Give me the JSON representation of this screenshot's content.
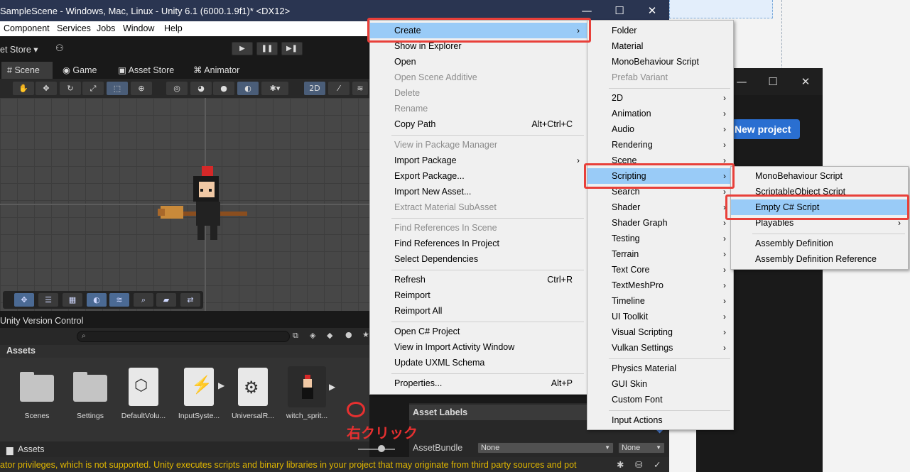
{
  "unity": {
    "title": "SampleScene - Windows, Mac, Linux - Unity 6.1 (6000.1.9f1)* <DX12>",
    "window_controls": [
      "—",
      "☐",
      "✕"
    ],
    "menubar": [
      "Component",
      "Services",
      "Jobs",
      "Window",
      "Help"
    ],
    "toolbar_left": "et Store",
    "tabs": [
      "Scene",
      "Game",
      "Asset Store",
      "Animator"
    ],
    "scene_mode_2d": "2D",
    "version_control": "Unity Version Control",
    "assets_header": "Assets",
    "assets": [
      "Scenes",
      "Settings",
      "DefaultVolu...",
      "InputSyste...",
      "UniversalR...",
      "witch_sprit..."
    ],
    "assets_footer": "Assets",
    "status_text": "ator privileges, which is not supported. Unity executes scripts and binary libraries in your project that may originate from third party sources and pot",
    "inspector": {
      "asset_labels": "Asset Labels",
      "assetbundle_label": "AssetBundle",
      "dropdown1": "None",
      "dropdown2": "None"
    }
  },
  "hub": {
    "new_project": "New project",
    "window_controls": [
      "—",
      "☐",
      "✕"
    ]
  },
  "annotation": {
    "label": "右クリック",
    "color": "#e63030"
  },
  "context_menu": {
    "items": [
      {
        "label": "Create",
        "submenu": true,
        "highlighted": true
      },
      {
        "label": "Show in Explorer"
      },
      {
        "label": "Open"
      },
      {
        "label": "Open Scene Additive",
        "disabled": true
      },
      {
        "label": "Delete",
        "disabled": true
      },
      {
        "label": "Rename",
        "disabled": true
      },
      {
        "label": "Copy Path",
        "shortcut": "Alt+Ctrl+C"
      },
      {
        "label": "View in Package Manager",
        "disabled": true
      },
      {
        "label": "Import Package",
        "submenu": true
      },
      {
        "label": "Export Package..."
      },
      {
        "label": "Import New Asset..."
      },
      {
        "label": "Extract Material SubAsset",
        "disabled": true
      },
      {
        "label": "Find References In Scene",
        "disabled": true
      },
      {
        "label": "Find References In Project"
      },
      {
        "label": "Select Dependencies"
      },
      {
        "label": "Refresh",
        "shortcut": "Ctrl+R"
      },
      {
        "label": "Reimport"
      },
      {
        "label": "Reimport All"
      },
      {
        "label": "Open C# Project"
      },
      {
        "label": "View in Import Activity Window"
      },
      {
        "label": "Update UXML Schema"
      },
      {
        "label": "Properties...",
        "shortcut": "Alt+P"
      }
    ]
  },
  "create_menu": {
    "items": [
      {
        "label": "Folder"
      },
      {
        "label": "Material"
      },
      {
        "label": "MonoBehaviour Script"
      },
      {
        "label": "Prefab Variant",
        "disabled": true
      },
      {
        "label": "2D",
        "submenu": true
      },
      {
        "label": "Animation",
        "submenu": true
      },
      {
        "label": "Audio",
        "submenu": true
      },
      {
        "label": "Rendering",
        "submenu": true
      },
      {
        "label": "Scene",
        "submenu": true
      },
      {
        "label": "Scripting",
        "submenu": true,
        "highlighted": true
      },
      {
        "label": "Search",
        "submenu": true
      },
      {
        "label": "Shader",
        "submenu": true
      },
      {
        "label": "Shader Graph",
        "submenu": true
      },
      {
        "label": "Testing",
        "submenu": true
      },
      {
        "label": "Terrain",
        "submenu": true
      },
      {
        "label": "Text Core",
        "submenu": true
      },
      {
        "label": "TextMeshPro",
        "submenu": true
      },
      {
        "label": "Timeline",
        "submenu": true
      },
      {
        "label": "UI Toolkit",
        "submenu": true
      },
      {
        "label": "Visual Scripting",
        "submenu": true
      },
      {
        "label": "Vulkan Settings",
        "submenu": true
      },
      {
        "label": "Physics Material"
      },
      {
        "label": "GUI Skin"
      },
      {
        "label": "Custom Font"
      },
      {
        "label": "Input Actions"
      }
    ]
  },
  "scripting_menu": {
    "items": [
      {
        "label": "MonoBehaviour Script"
      },
      {
        "label": "ScriptableObject Script"
      },
      {
        "label": "Empty C# Script",
        "highlighted": true
      },
      {
        "label": "Playables",
        "submenu": true
      },
      {
        "label": "Assembly Definition"
      },
      {
        "label": "Assembly Definition Reference"
      }
    ]
  }
}
